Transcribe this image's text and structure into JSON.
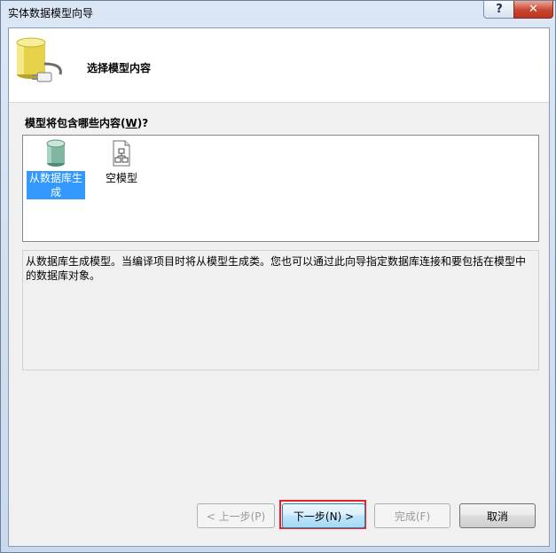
{
  "window": {
    "title": "实体数据模型向导",
    "help_glyph": "?",
    "close_glyph": "✕"
  },
  "header": {
    "title": "选择模型内容"
  },
  "content": {
    "label_prefix": "模型将包含哪些内容(",
    "label_key": "W",
    "label_suffix": ")?",
    "items": [
      {
        "label": "从数据库生成",
        "selected": true
      },
      {
        "label": "空模型",
        "selected": false
      }
    ],
    "description": "从数据库生成模型。当编译项目时将从模型生成类。您也可以通过此向导指定数据库连接和要包括在模型中的数据库对象。"
  },
  "buttons": {
    "prev": "< 上一步(P)",
    "next": "下一步(N) >",
    "finish": "完成(F)",
    "cancel": "取消"
  },
  "colors": {
    "selection": "#3399ff",
    "highlight_border": "#e8202a",
    "close_button": "#c9452f"
  }
}
